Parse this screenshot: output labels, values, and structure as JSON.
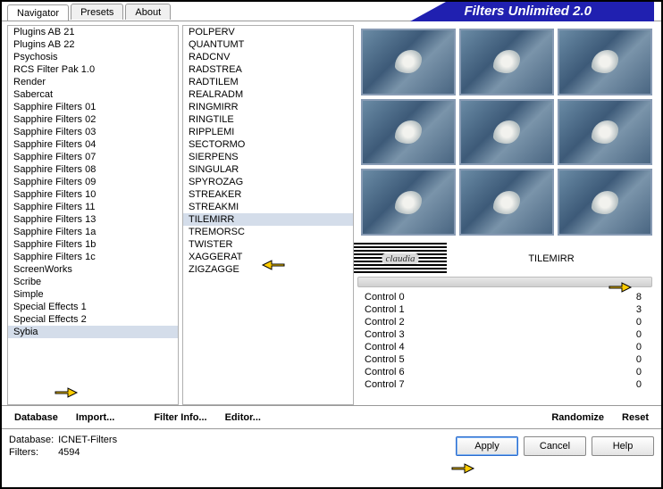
{
  "app_title": "Filters Unlimited 2.0",
  "tabs": {
    "t0": "Navigator",
    "t1": "Presets",
    "t2": "About"
  },
  "categories": [
    "Plugins AB 21",
    "Plugins AB 22",
    "Psychosis",
    "RCS Filter Pak 1.0",
    "Render",
    "Sabercat",
    "Sapphire Filters 01",
    "Sapphire Filters 02",
    "Sapphire Filters 03",
    "Sapphire Filters 04",
    "Sapphire Filters 07",
    "Sapphire Filters 08",
    "Sapphire Filters 09",
    "Sapphire Filters 10",
    "Sapphire Filters 11",
    "Sapphire Filters 13",
    "Sapphire Filters 1a",
    "Sapphire Filters 1b",
    "Sapphire Filters 1c",
    "ScreenWorks",
    "Scribe",
    "Simple",
    "Special Effects 1",
    "Special Effects 2",
    "Sybia"
  ],
  "selected_category_idx": 24,
  "filters": [
    "POLPERV",
    "QUANTUMT",
    "RADCNV",
    "RADSTREA",
    "RADTILEM",
    "REALRADM",
    "RINGMIRR",
    "RINGTILE",
    "RIPPLEMI",
    "SECTORMO",
    "SIERPENS",
    "SINGULAR",
    "SPYROZAG",
    "STREAKER",
    "STREAKMI",
    "TILEMIRR",
    "TREMORSC",
    "TWISTER",
    "XAGGERAT",
    "ZIGZAGGE"
  ],
  "selected_filter_idx": 15,
  "current_filter_name": "TILEMIRR",
  "controls": [
    {
      "label": "Control 0",
      "value": "8"
    },
    {
      "label": "Control 1",
      "value": "3"
    },
    {
      "label": "Control 2",
      "value": "0"
    },
    {
      "label": "Control 3",
      "value": "0"
    },
    {
      "label": "Control 4",
      "value": "0"
    },
    {
      "label": "Control 5",
      "value": "0"
    },
    {
      "label": "Control 6",
      "value": "0"
    },
    {
      "label": "Control 7",
      "value": "0"
    }
  ],
  "buttons": {
    "database": "Database",
    "import": "Import...",
    "filter_info": "Filter Info...",
    "editor": "Editor...",
    "randomize": "Randomize",
    "reset": "Reset",
    "apply": "Apply",
    "cancel": "Cancel",
    "help": "Help"
  },
  "footer": {
    "db_label": "Database:",
    "db_value": "ICNET-Filters",
    "filters_label": "Filters:",
    "filters_value": "4594"
  }
}
